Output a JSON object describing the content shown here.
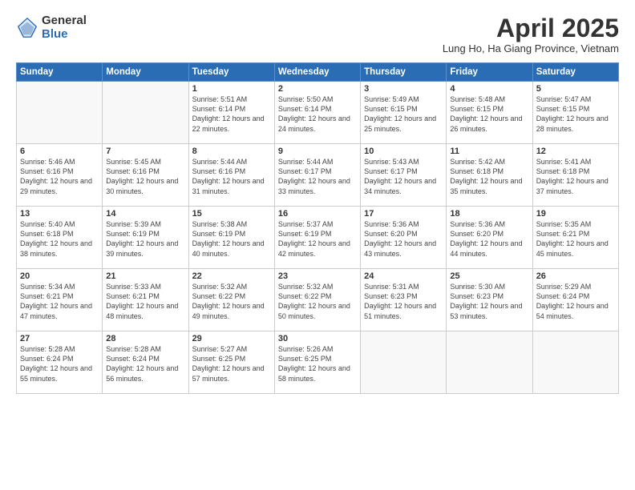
{
  "logo": {
    "general": "General",
    "blue": "Blue"
  },
  "title": "April 2025",
  "subtitle": "Lung Ho, Ha Giang Province, Vietnam",
  "days_of_week": [
    "Sunday",
    "Monday",
    "Tuesday",
    "Wednesday",
    "Thursday",
    "Friday",
    "Saturday"
  ],
  "weeks": [
    [
      {
        "day": "",
        "sunrise": "",
        "sunset": "",
        "daylight": ""
      },
      {
        "day": "",
        "sunrise": "",
        "sunset": "",
        "daylight": ""
      },
      {
        "day": "1",
        "sunrise": "Sunrise: 5:51 AM",
        "sunset": "Sunset: 6:14 PM",
        "daylight": "Daylight: 12 hours and 22 minutes."
      },
      {
        "day": "2",
        "sunrise": "Sunrise: 5:50 AM",
        "sunset": "Sunset: 6:14 PM",
        "daylight": "Daylight: 12 hours and 24 minutes."
      },
      {
        "day": "3",
        "sunrise": "Sunrise: 5:49 AM",
        "sunset": "Sunset: 6:15 PM",
        "daylight": "Daylight: 12 hours and 25 minutes."
      },
      {
        "day": "4",
        "sunrise": "Sunrise: 5:48 AM",
        "sunset": "Sunset: 6:15 PM",
        "daylight": "Daylight: 12 hours and 26 minutes."
      },
      {
        "day": "5",
        "sunrise": "Sunrise: 5:47 AM",
        "sunset": "Sunset: 6:15 PM",
        "daylight": "Daylight: 12 hours and 28 minutes."
      }
    ],
    [
      {
        "day": "6",
        "sunrise": "Sunrise: 5:46 AM",
        "sunset": "Sunset: 6:16 PM",
        "daylight": "Daylight: 12 hours and 29 minutes."
      },
      {
        "day": "7",
        "sunrise": "Sunrise: 5:45 AM",
        "sunset": "Sunset: 6:16 PM",
        "daylight": "Daylight: 12 hours and 30 minutes."
      },
      {
        "day": "8",
        "sunrise": "Sunrise: 5:44 AM",
        "sunset": "Sunset: 6:16 PM",
        "daylight": "Daylight: 12 hours and 31 minutes."
      },
      {
        "day": "9",
        "sunrise": "Sunrise: 5:44 AM",
        "sunset": "Sunset: 6:17 PM",
        "daylight": "Daylight: 12 hours and 33 minutes."
      },
      {
        "day": "10",
        "sunrise": "Sunrise: 5:43 AM",
        "sunset": "Sunset: 6:17 PM",
        "daylight": "Daylight: 12 hours and 34 minutes."
      },
      {
        "day": "11",
        "sunrise": "Sunrise: 5:42 AM",
        "sunset": "Sunset: 6:18 PM",
        "daylight": "Daylight: 12 hours and 35 minutes."
      },
      {
        "day": "12",
        "sunrise": "Sunrise: 5:41 AM",
        "sunset": "Sunset: 6:18 PM",
        "daylight": "Daylight: 12 hours and 37 minutes."
      }
    ],
    [
      {
        "day": "13",
        "sunrise": "Sunrise: 5:40 AM",
        "sunset": "Sunset: 6:18 PM",
        "daylight": "Daylight: 12 hours and 38 minutes."
      },
      {
        "day": "14",
        "sunrise": "Sunrise: 5:39 AM",
        "sunset": "Sunset: 6:19 PM",
        "daylight": "Daylight: 12 hours and 39 minutes."
      },
      {
        "day": "15",
        "sunrise": "Sunrise: 5:38 AM",
        "sunset": "Sunset: 6:19 PM",
        "daylight": "Daylight: 12 hours and 40 minutes."
      },
      {
        "day": "16",
        "sunrise": "Sunrise: 5:37 AM",
        "sunset": "Sunset: 6:19 PM",
        "daylight": "Daylight: 12 hours and 42 minutes."
      },
      {
        "day": "17",
        "sunrise": "Sunrise: 5:36 AM",
        "sunset": "Sunset: 6:20 PM",
        "daylight": "Daylight: 12 hours and 43 minutes."
      },
      {
        "day": "18",
        "sunrise": "Sunrise: 5:36 AM",
        "sunset": "Sunset: 6:20 PM",
        "daylight": "Daylight: 12 hours and 44 minutes."
      },
      {
        "day": "19",
        "sunrise": "Sunrise: 5:35 AM",
        "sunset": "Sunset: 6:21 PM",
        "daylight": "Daylight: 12 hours and 45 minutes."
      }
    ],
    [
      {
        "day": "20",
        "sunrise": "Sunrise: 5:34 AM",
        "sunset": "Sunset: 6:21 PM",
        "daylight": "Daylight: 12 hours and 47 minutes."
      },
      {
        "day": "21",
        "sunrise": "Sunrise: 5:33 AM",
        "sunset": "Sunset: 6:21 PM",
        "daylight": "Daylight: 12 hours and 48 minutes."
      },
      {
        "day": "22",
        "sunrise": "Sunrise: 5:32 AM",
        "sunset": "Sunset: 6:22 PM",
        "daylight": "Daylight: 12 hours and 49 minutes."
      },
      {
        "day": "23",
        "sunrise": "Sunrise: 5:32 AM",
        "sunset": "Sunset: 6:22 PM",
        "daylight": "Daylight: 12 hours and 50 minutes."
      },
      {
        "day": "24",
        "sunrise": "Sunrise: 5:31 AM",
        "sunset": "Sunset: 6:23 PM",
        "daylight": "Daylight: 12 hours and 51 minutes."
      },
      {
        "day": "25",
        "sunrise": "Sunrise: 5:30 AM",
        "sunset": "Sunset: 6:23 PM",
        "daylight": "Daylight: 12 hours and 53 minutes."
      },
      {
        "day": "26",
        "sunrise": "Sunrise: 5:29 AM",
        "sunset": "Sunset: 6:24 PM",
        "daylight": "Daylight: 12 hours and 54 minutes."
      }
    ],
    [
      {
        "day": "27",
        "sunrise": "Sunrise: 5:28 AM",
        "sunset": "Sunset: 6:24 PM",
        "daylight": "Daylight: 12 hours and 55 minutes."
      },
      {
        "day": "28",
        "sunrise": "Sunrise: 5:28 AM",
        "sunset": "Sunset: 6:24 PM",
        "daylight": "Daylight: 12 hours and 56 minutes."
      },
      {
        "day": "29",
        "sunrise": "Sunrise: 5:27 AM",
        "sunset": "Sunset: 6:25 PM",
        "daylight": "Daylight: 12 hours and 57 minutes."
      },
      {
        "day": "30",
        "sunrise": "Sunrise: 5:26 AM",
        "sunset": "Sunset: 6:25 PM",
        "daylight": "Daylight: 12 hours and 58 minutes."
      },
      {
        "day": "",
        "sunrise": "",
        "sunset": "",
        "daylight": ""
      },
      {
        "day": "",
        "sunrise": "",
        "sunset": "",
        "daylight": ""
      },
      {
        "day": "",
        "sunrise": "",
        "sunset": "",
        "daylight": ""
      }
    ]
  ]
}
